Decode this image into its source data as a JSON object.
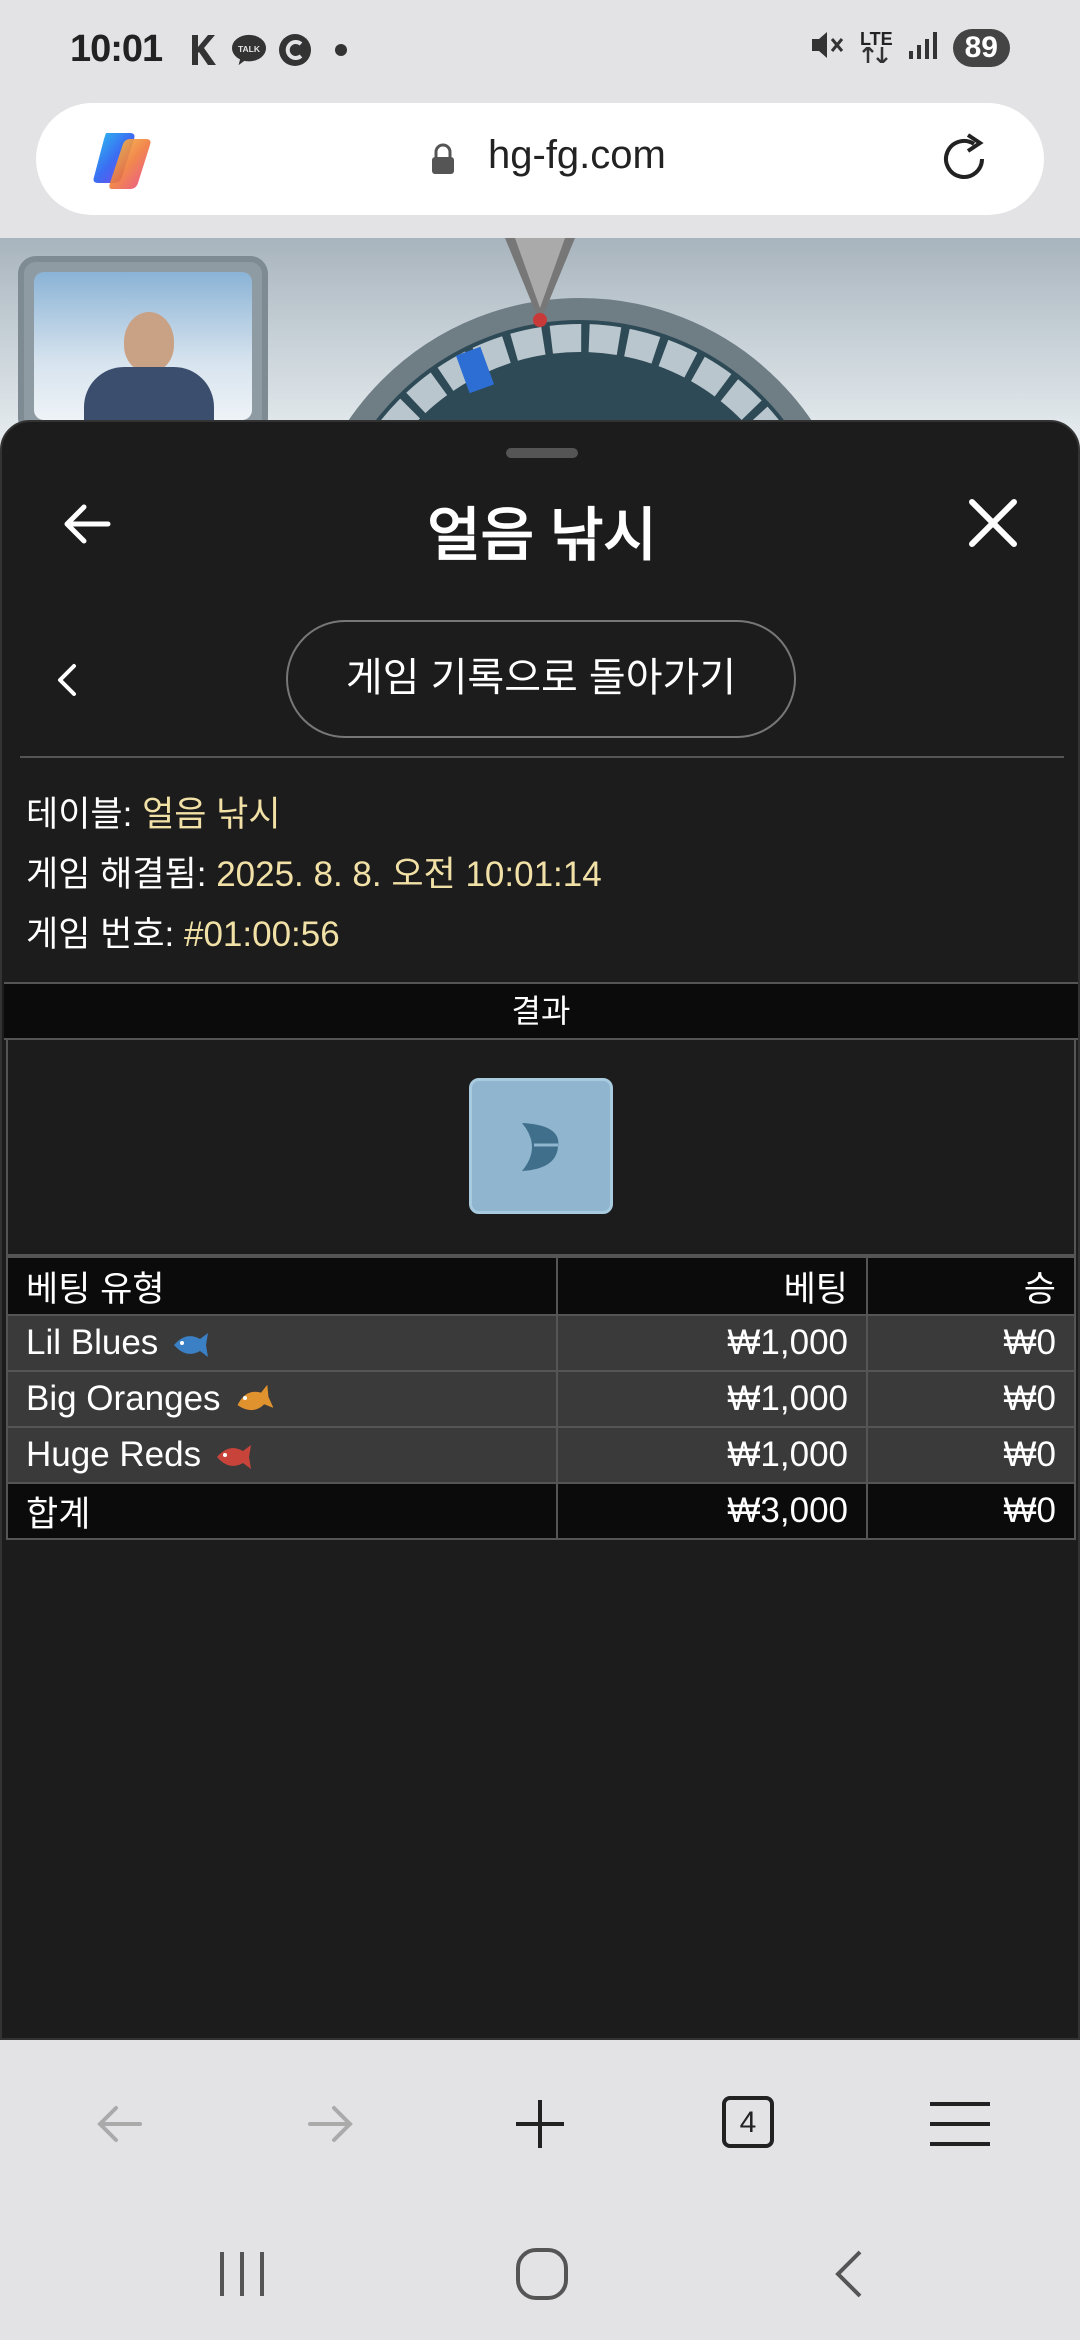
{
  "status_bar": {
    "time": "10:01",
    "talk_label": "TALK",
    "battery": "89",
    "network": "LTE"
  },
  "browser": {
    "url": "hg-fg.com",
    "tab_count": "4"
  },
  "sheet": {
    "title": "얼음 낚시",
    "history_button": "게임 기록으로 돌아가기"
  },
  "info": {
    "table_label": "테이블: ",
    "table_value": "얼음 낚시",
    "resolved_label": "게임 해결됨: ",
    "resolved_value": "2025. 8. 8. 오전 10:01:14",
    "game_no_label": "게임 번호: ",
    "game_no_value": "#01:00:56"
  },
  "result": {
    "header": "결과"
  },
  "bets_table": {
    "headers": [
      "베팅 유형",
      "베팅",
      "승"
    ],
    "rows": [
      {
        "type": "Lil Blues",
        "bet": "₩1,000",
        "win": "₩0",
        "icon": "blue-fish-icon",
        "color": "#3b7fc4"
      },
      {
        "type": "Big Oranges",
        "bet": "₩1,000",
        "win": "₩0",
        "icon": "orange-fish-icon",
        "color": "#e0922f"
      },
      {
        "type": "Huge Reds",
        "bet": "₩1,000",
        "win": "₩0",
        "icon": "red-fish-icon",
        "color": "#c8443a"
      }
    ],
    "total": {
      "label": "합계",
      "bet": "₩3,000",
      "win": "₩0"
    }
  },
  "colors": {
    "sheet_bg": "#1c1c1c",
    "info_value": "#f2e1a6",
    "result_tile": "#8fb5cf"
  }
}
